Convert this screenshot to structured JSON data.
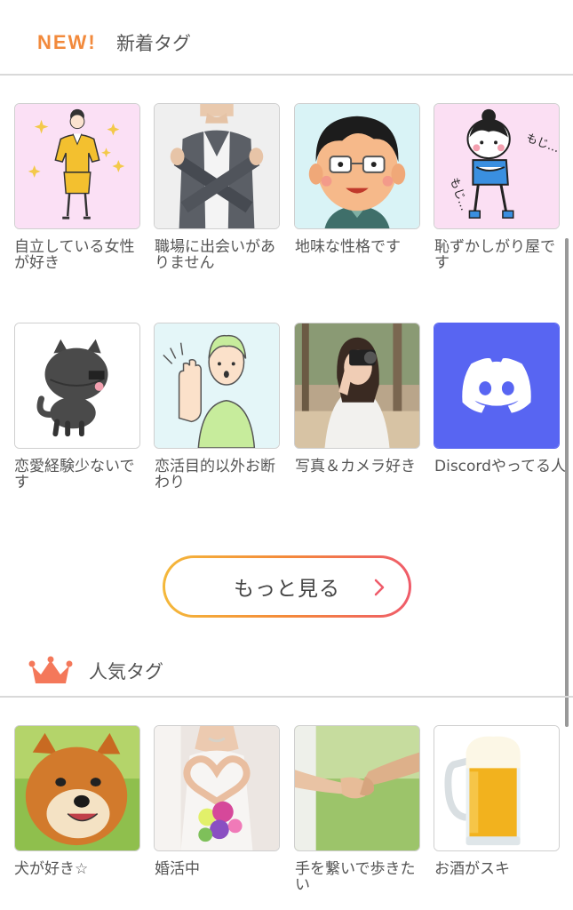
{
  "new_section": {
    "badge": "NEW!",
    "title": "新着タグ",
    "tags": [
      {
        "label": "自立している女性が好き",
        "image": "businesswoman-illustration"
      },
      {
        "label": "職場に出会いがありません",
        "image": "crossed-arms-photo"
      },
      {
        "label": "地味な性格です",
        "image": "glasses-man-illustration"
      },
      {
        "label": "恥ずかしがり屋です",
        "image": "shy-girl-illustration",
        "image_text": "もじ…"
      },
      {
        "label": "恋愛経験少ないです",
        "image": "black-cat-illustration"
      },
      {
        "label": "恋活目的以外お断わり",
        "image": "stop-hand-illustration"
      },
      {
        "label": "写真＆カメラ好き",
        "image": "camera-woman-photo"
      },
      {
        "label": "Discordやってる人",
        "image": "discord-logo"
      }
    ]
  },
  "more_button": {
    "label": "もっと見る",
    "icon": "chevron-right-icon"
  },
  "popular_section": {
    "icon": "crown-icon",
    "title": "人気タグ",
    "tags": [
      {
        "label": "犬が好き☆",
        "image": "shiba-dog-photo"
      },
      {
        "label": "婚活中",
        "image": "bride-heart-photo"
      },
      {
        "label": "手を繋いで歩きたい",
        "image": "holding-hands-photo"
      },
      {
        "label": "お酒がスキ",
        "image": "beer-mug-photo"
      }
    ]
  },
  "colors": {
    "accent_orange": "#f28a3c",
    "button_gradient": [
      "#f4b83a",
      "#f48a3a",
      "#ef5b6a"
    ],
    "discord_blue": "#5865f2",
    "crown": "#f4785a"
  }
}
